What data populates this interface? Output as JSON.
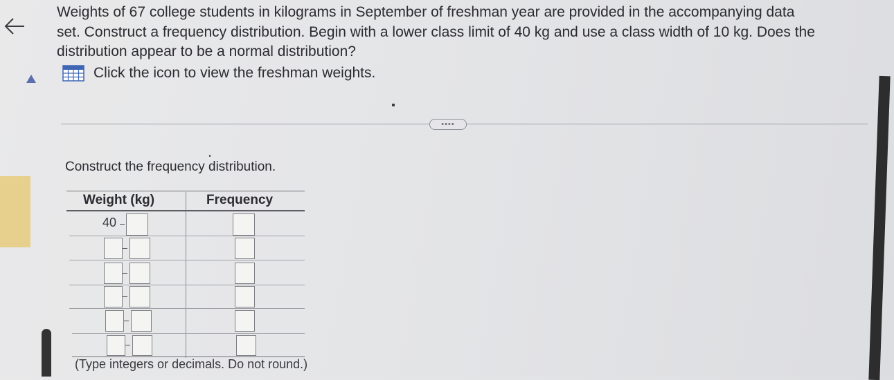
{
  "navigation": {
    "back_icon": "left-arrow-icon"
  },
  "question": {
    "lines": [
      "Weights of 67 college students in kilograms in September of freshman year are provided in the accompanying data",
      "set. Construct a frequency distribution. Begin with a lower class limit of 40 kg and use a class width of 10 kg. Does the",
      "distribution appear to be a normal distribution?"
    ],
    "data_link_icon": "table-grid-icon",
    "data_link_text": "Click the icon to view the freshman weights."
  },
  "more_button": {
    "label": "••••"
  },
  "part": {
    "prompt": "Construct the frequency distribution.",
    "table": {
      "headers": {
        "weight": "Weight (kg)",
        "frequency": "Frequency"
      },
      "first_lower_limit": "40",
      "dash": "–",
      "rows": [
        {
          "lower": "40",
          "upper": "",
          "frequency": ""
        },
        {
          "lower": "",
          "upper": "",
          "frequency": ""
        },
        {
          "lower": "",
          "upper": "",
          "frequency": ""
        },
        {
          "lower": "",
          "upper": "",
          "frequency": ""
        },
        {
          "lower": "",
          "upper": "",
          "frequency": ""
        },
        {
          "lower": "",
          "upper": "",
          "frequency": ""
        }
      ]
    },
    "hint": "(Type integers or decimals. Do not round.)"
  },
  "colors": {
    "accent_blue": "#4a6fb3",
    "tab_yellow": "#e7cf8e"
  }
}
